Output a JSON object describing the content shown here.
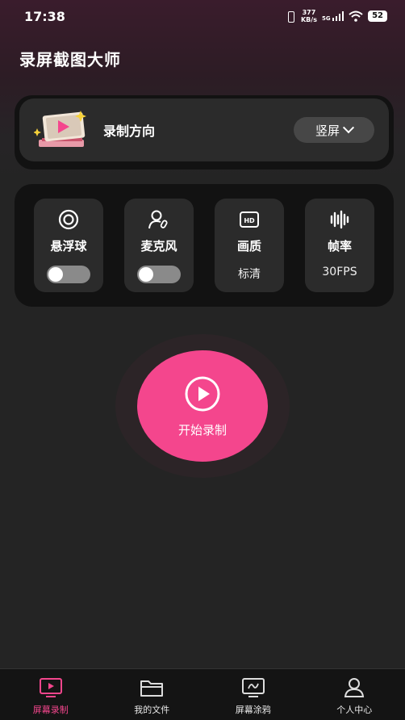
{
  "status_bar": {
    "time": "17:38",
    "net_speed_value": "377",
    "net_speed_unit": "KB/s",
    "network": "5G",
    "battery": "52"
  },
  "app": {
    "title": "录屏截图大师"
  },
  "direction": {
    "label": "录制方向",
    "value": "竖屏"
  },
  "options": [
    {
      "label": "悬浮球",
      "type": "toggle",
      "on": false
    },
    {
      "label": "麦克风",
      "type": "toggle",
      "on": false
    },
    {
      "label": "画质",
      "type": "value",
      "value": "标清"
    },
    {
      "label": "帧率",
      "type": "value",
      "value": "30FPS"
    }
  ],
  "record": {
    "label": "开始录制"
  },
  "tabs": [
    {
      "label": "屏幕录制",
      "icon": "monitor-play-icon",
      "active": true
    },
    {
      "label": "我的文件",
      "icon": "folder-icon",
      "active": false
    },
    {
      "label": "屏幕涂鸦",
      "icon": "monitor-doodle-icon",
      "active": false
    },
    {
      "label": "个人中心",
      "icon": "user-icon",
      "active": false
    }
  ],
  "colors": {
    "accent": "#f4468d",
    "background": "#242424",
    "card": "#2b2b2b"
  }
}
